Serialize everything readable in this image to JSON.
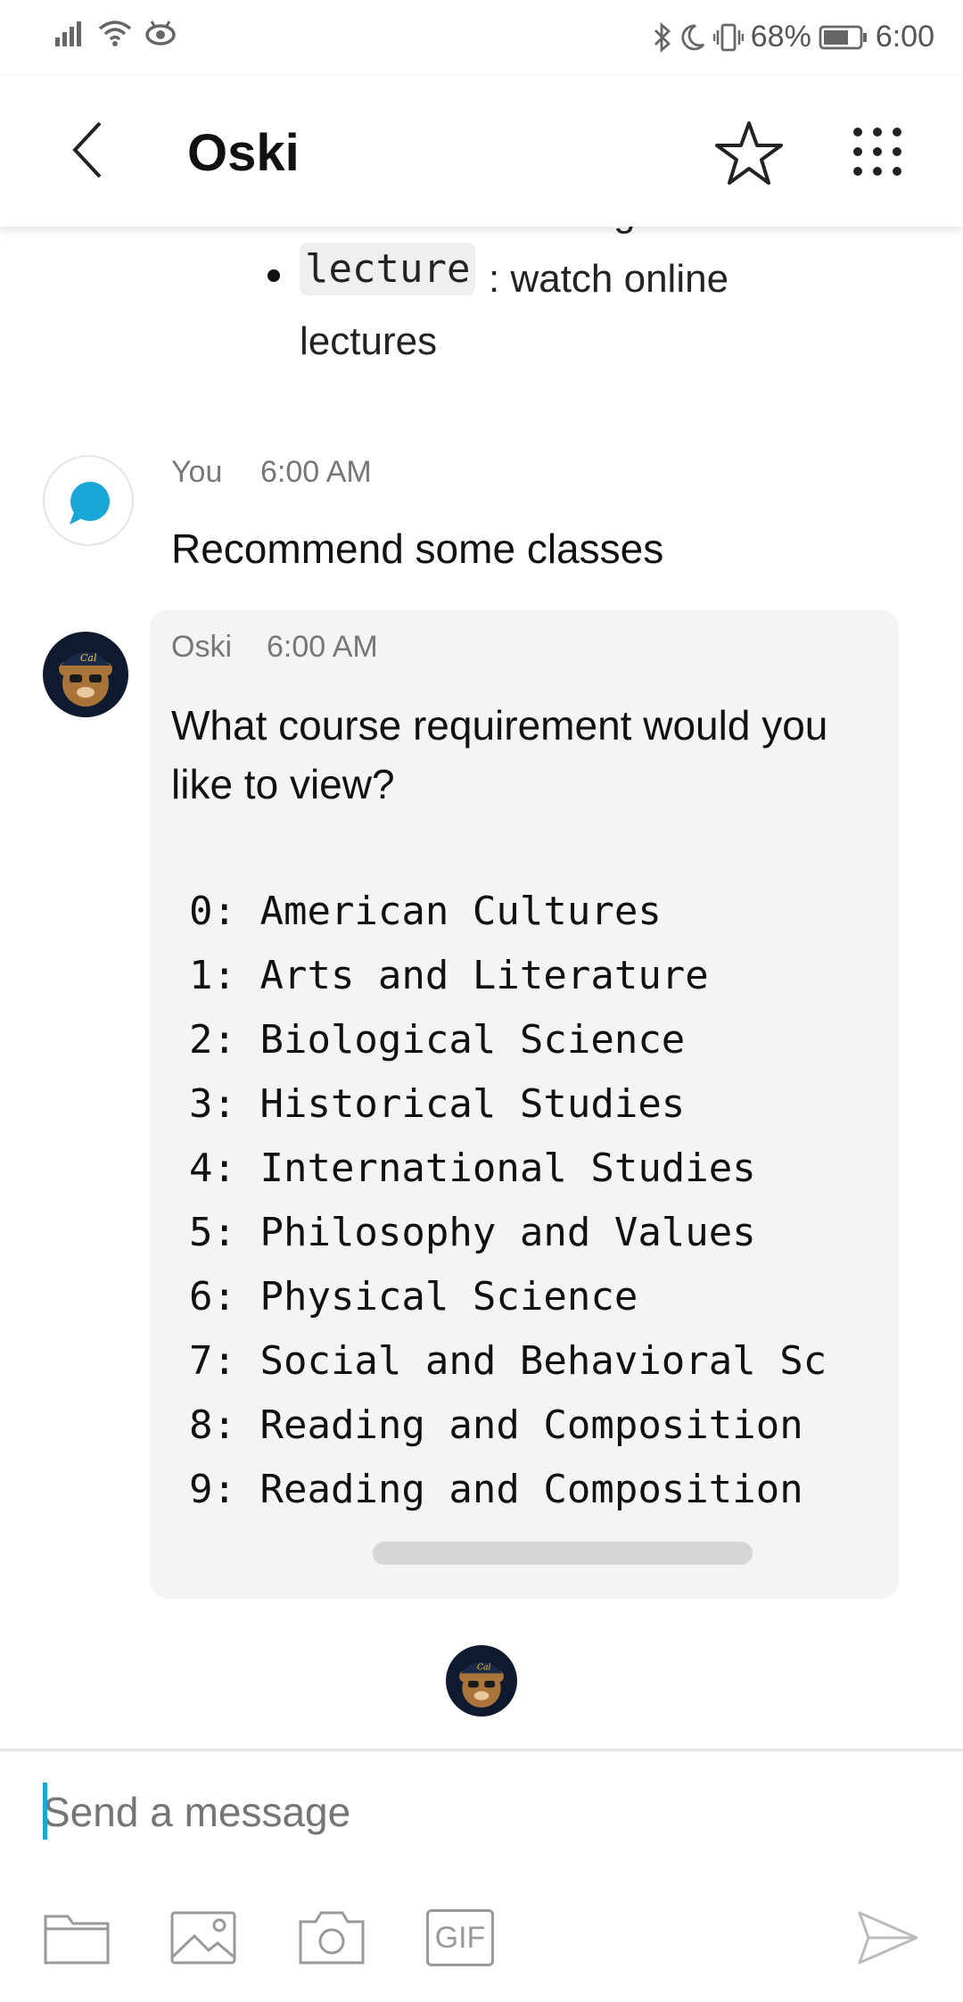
{
  "status_bar": {
    "battery_percent": "68%",
    "time": "6:00"
  },
  "header": {
    "title": "Oski"
  },
  "previous_message": {
    "clipped_text": "reminders on Google Calendar",
    "bullet_code": "lecture",
    "bullet_text_rest": ": watch online lectures"
  },
  "user_message": {
    "sender": "You",
    "time": "6:00 AM",
    "text": "Recommend some classes"
  },
  "bot_message": {
    "sender": "Oski",
    "time": "6:00 AM",
    "question": "What course requirement would you like to view?",
    "options": [
      "0: American Cultures",
      "1: Arts and Literature",
      "2: Biological Science",
      "3: Historical Studies",
      "4: International Studies",
      "5: Philosophy and Values",
      "6: Physical Science",
      "7: Social and Behavioral Sc",
      "8: Reading and Composition",
      "9: Reading and Composition"
    ]
  },
  "composer": {
    "placeholder": "Send a message",
    "gif_label": "GIF"
  },
  "colors": {
    "accent": "#1aa7d8",
    "bubble_bg": "#f4f4f4",
    "divider": "#e6e6e6"
  },
  "icons": {
    "back": "back-chevron-icon",
    "star": "star-icon",
    "menu": "grid-menu-icon",
    "folder": "folder-icon",
    "image": "image-icon",
    "camera": "camera-icon",
    "gif": "gif-icon",
    "send": "send-icon"
  }
}
